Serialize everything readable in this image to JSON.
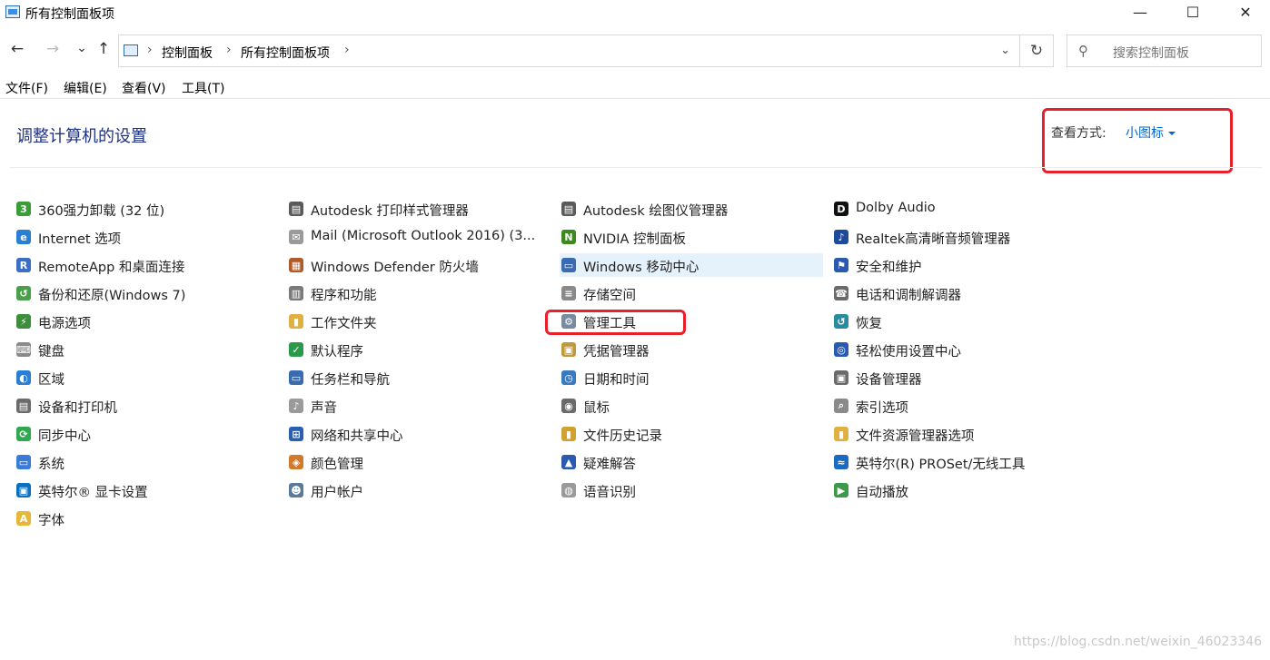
{
  "window": {
    "title": "所有控制面板项",
    "minimize": "—",
    "maximize": "☐",
    "close": "✕"
  },
  "nav": {
    "back": "←",
    "forward": "→",
    "recent": "⌄",
    "up": "↑",
    "separator": "›",
    "breadcrumbs": [
      "控制面板",
      "所有控制面板项"
    ],
    "dropdown": "⌄",
    "refresh": "↻",
    "search_icon": "⚲",
    "search_placeholder": "搜索控制面板"
  },
  "menu": [
    "文件(F)",
    "编辑(E)",
    "查看(V)",
    "工具(T)"
  ],
  "heading": "调整计算机的设置",
  "view": {
    "label": "查看方式:",
    "value": "小图标"
  },
  "columns": [
    [
      {
        "label": "360强力卸载 (32 位)",
        "icon": "uninstall-icon",
        "color": "#3a9d3a",
        "glyph": "3"
      },
      {
        "label": "Internet 选项",
        "icon": "globe-icon",
        "color": "#2a7fd4",
        "glyph": "e"
      },
      {
        "label": "RemoteApp 和桌面连接",
        "icon": "remote-desktop-icon",
        "color": "#3b6ec7",
        "glyph": "R"
      },
      {
        "label": "备份和还原(Windows 7)",
        "icon": "backup-icon",
        "color": "#4aa04a",
        "glyph": "↺"
      },
      {
        "label": "电源选项",
        "icon": "power-icon",
        "color": "#3c8d3c",
        "glyph": "⚡"
      },
      {
        "label": "键盘",
        "icon": "keyboard-icon",
        "color": "#8a8a8a",
        "glyph": "⌨"
      },
      {
        "label": "区域",
        "icon": "region-globe-icon",
        "color": "#2a7fd4",
        "glyph": "◐"
      },
      {
        "label": "设备和打印机",
        "icon": "printer-icon",
        "color": "#6b6b6b",
        "glyph": "▤"
      },
      {
        "label": "同步中心",
        "icon": "sync-icon",
        "color": "#2fa84f",
        "glyph": "⟳"
      },
      {
        "label": "系统",
        "icon": "computer-icon",
        "color": "#3a7bd5",
        "glyph": "▭"
      },
      {
        "label": "英特尔® 显卡设置",
        "icon": "intel-graphics-icon",
        "color": "#0a70c2",
        "glyph": "▣"
      },
      {
        "label": "字体",
        "icon": "font-folder-icon",
        "color": "#e6b83a",
        "glyph": "A"
      }
    ],
    [
      {
        "label": "Autodesk 打印样式管理器",
        "icon": "printer-style-icon",
        "color": "#5a5a5a",
        "glyph": "▤"
      },
      {
        "label": "Mail (Microsoft Outlook 2016) (3...",
        "icon": "mail-icon",
        "color": "#9a9a9a",
        "glyph": "✉"
      },
      {
        "label": "Windows Defender 防火墙",
        "icon": "firewall-icon",
        "color": "#b05a2a",
        "glyph": "▦"
      },
      {
        "label": "程序和功能",
        "icon": "programs-icon",
        "color": "#7a7a7a",
        "glyph": "▥"
      },
      {
        "label": "工作文件夹",
        "icon": "work-folder-icon",
        "color": "#e0b040",
        "glyph": "▮"
      },
      {
        "label": "默认程序",
        "icon": "default-programs-icon",
        "color": "#2a9a4a",
        "glyph": "✓"
      },
      {
        "label": "任务栏和导航",
        "icon": "taskbar-icon",
        "color": "#3a6ab0",
        "glyph": "▭"
      },
      {
        "label": "声音",
        "icon": "sound-icon",
        "color": "#9a9a9a",
        "glyph": "♪"
      },
      {
        "label": "网络和共享中心",
        "icon": "network-icon",
        "color": "#2a5fb0",
        "glyph": "⊞"
      },
      {
        "label": "颜色管理",
        "icon": "color-management-icon",
        "color": "#d07a2a",
        "glyph": "◈"
      },
      {
        "label": "用户帐户",
        "icon": "user-accounts-icon",
        "color": "#5a7a9a",
        "glyph": "☻"
      }
    ],
    [
      {
        "label": "Autodesk 绘图仪管理器",
        "icon": "plotter-icon",
        "color": "#5a5a5a",
        "glyph": "▤"
      },
      {
        "label": "NVIDIA 控制面板",
        "icon": "nvidia-icon",
        "color": "#3c8a1e",
        "glyph": "N"
      },
      {
        "label": "Windows 移动中心",
        "icon": "mobility-center-icon",
        "color": "#3a6ab0",
        "glyph": "▭",
        "selected": true
      },
      {
        "label": "存储空间",
        "icon": "storage-icon",
        "color": "#8a8a8a",
        "glyph": "≡"
      },
      {
        "label": "管理工具",
        "icon": "admin-tools-icon",
        "color": "#7a8aa0",
        "glyph": "⚙"
      },
      {
        "label": "凭据管理器",
        "icon": "credential-icon",
        "color": "#c09a3a",
        "glyph": "▣"
      },
      {
        "label": "日期和时间",
        "icon": "clock-icon",
        "color": "#3a7ac0",
        "glyph": "◷"
      },
      {
        "label": "鼠标",
        "icon": "mouse-icon",
        "color": "#6a6a6a",
        "glyph": "◉"
      },
      {
        "label": "文件历史记录",
        "icon": "file-history-icon",
        "color": "#d0a030",
        "glyph": "▮"
      },
      {
        "label": "疑难解答",
        "icon": "troubleshoot-icon",
        "color": "#2a5ab0",
        "glyph": "▲"
      },
      {
        "label": "语音识别",
        "icon": "microphone-icon",
        "color": "#9a9a9a",
        "glyph": "◍"
      }
    ],
    [
      {
        "label": "Dolby Audio",
        "icon": "dolby-icon",
        "color": "#111111",
        "glyph": "D"
      },
      {
        "label": "Realtek高清晰音频管理器",
        "icon": "realtek-icon",
        "color": "#1f4a9a",
        "glyph": "♪"
      },
      {
        "label": "安全和维护",
        "icon": "flag-icon",
        "color": "#2a5ab0",
        "glyph": "⚑"
      },
      {
        "label": "电话和调制解调器",
        "icon": "phone-icon",
        "color": "#6a6a6a",
        "glyph": "☎"
      },
      {
        "label": "恢复",
        "icon": "recovery-icon",
        "color": "#2a8aa0",
        "glyph": "↺"
      },
      {
        "label": "轻松使用设置中心",
        "icon": "ease-of-access-icon",
        "color": "#2a5ab0",
        "glyph": "◎"
      },
      {
        "label": "设备管理器",
        "icon": "device-manager-icon",
        "color": "#6a6a6a",
        "glyph": "▣"
      },
      {
        "label": "索引选项",
        "icon": "indexing-icon",
        "color": "#8a8a8a",
        "glyph": "⌕"
      },
      {
        "label": "文件资源管理器选项",
        "icon": "explorer-options-icon",
        "color": "#e0b040",
        "glyph": "▮"
      },
      {
        "label": "英特尔(R) PROSet/无线工具",
        "icon": "wireless-icon",
        "color": "#1a6ac0",
        "glyph": "≈"
      },
      {
        "label": "自动播放",
        "icon": "autoplay-icon",
        "color": "#3a9a4a",
        "glyph": "▶"
      }
    ]
  ],
  "watermark": "https://blog.csdn.net/weixin_46023346",
  "accent": "#0066cc",
  "highlight_color": "#e8202a"
}
